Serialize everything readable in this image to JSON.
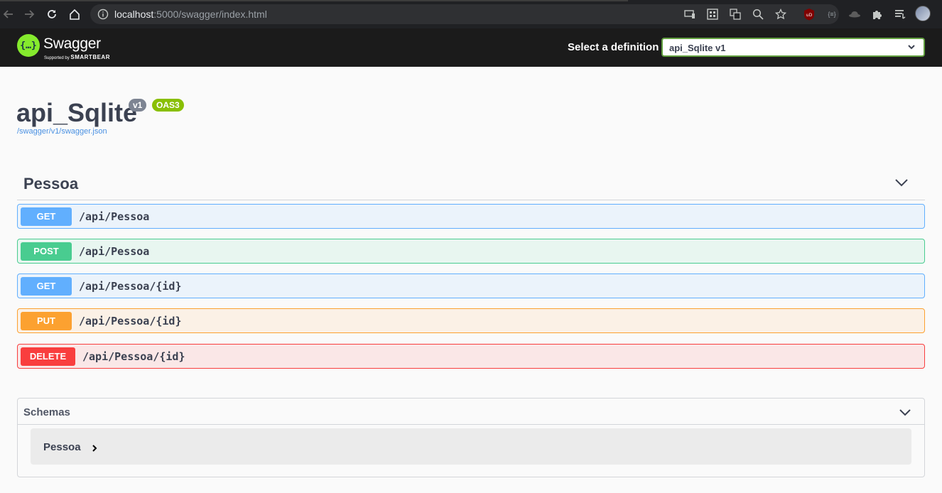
{
  "browser": {
    "url_host": "localhost",
    "url_rest": ":5000/swagger/index.html",
    "icons": [
      "back-arrow-icon",
      "forward-arrow-icon",
      "reload-icon",
      "home-icon",
      "info-icon",
      "cast-icon",
      "apps-icon",
      "translate-icon",
      "zoom-icon",
      "star-icon",
      "ublock-icon",
      "extension-icon",
      "hat-icon",
      "puzzle-icon",
      "reading-list-icon",
      "profile-avatar"
    ]
  },
  "topbar": {
    "brand": "Swagger",
    "brand_supported": "Supported by",
    "brand_company": "SMARTBEAR",
    "definition_label": "Select a definition",
    "definition_value": "api_Sqlite v1",
    "accent_color": "#85ea2d"
  },
  "info": {
    "title": "api_Sqlite",
    "version": "v1",
    "oas": "OAS3",
    "spec_url": "/swagger/v1/swagger.json"
  },
  "tag": {
    "name": "Pessoa"
  },
  "operations": [
    {
      "method": "GET",
      "path": "/api/Pessoa",
      "color": "#61affe"
    },
    {
      "method": "POST",
      "path": "/api/Pessoa",
      "color": "#49cc90"
    },
    {
      "method": "GET",
      "path": "/api/Pessoa/{id}",
      "color": "#61affe"
    },
    {
      "method": "PUT",
      "path": "/api/Pessoa/{id}",
      "color": "#fca130"
    },
    {
      "method": "DELETE",
      "path": "/api/Pessoa/{id}",
      "color": "#f93e3e"
    }
  ],
  "schemas": {
    "title": "Schemas",
    "models": [
      "Pessoa"
    ]
  }
}
